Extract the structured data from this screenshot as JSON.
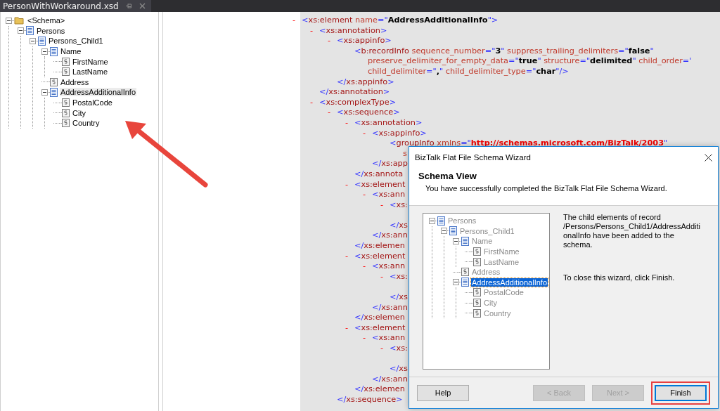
{
  "document_tab": {
    "title": "PersonWithWorkaround.xsd"
  },
  "schema_tree": [
    {
      "label": "<Schema>",
      "kind": "folder",
      "expanded": true,
      "selected": false,
      "children": [
        {
          "label": "Persons",
          "kind": "record",
          "expanded": true,
          "selected": false,
          "children": [
            {
              "label": "Persons_Child1",
              "kind": "record",
              "expanded": true,
              "selected": false,
              "children": [
                {
                  "label": "Name",
                  "kind": "record",
                  "expanded": true,
                  "selected": false,
                  "children": [
                    {
                      "label": "FirstName",
                      "kind": "field",
                      "selected": false
                    },
                    {
                      "label": "LastName",
                      "kind": "field",
                      "selected": false
                    }
                  ]
                },
                {
                  "label": "Address",
                  "kind": "field",
                  "selected": false
                },
                {
                  "label": "AddressAdditionalInfo",
                  "kind": "record",
                  "expanded": true,
                  "selected": true,
                  "children": [
                    {
                      "label": "PostalCode",
                      "kind": "field",
                      "selected": false
                    },
                    {
                      "label": "City",
                      "kind": "field",
                      "selected": false
                    },
                    {
                      "label": "Country",
                      "kind": "field",
                      "selected": false
                    }
                  ]
                }
              ]
            }
          ]
        }
      ]
    }
  ],
  "xml_view": [
    {
      "toggle": "-",
      "open": [
        {
          "kind": "punct",
          "text": "<"
        },
        {
          "kind": "tag",
          "text": "xs:element"
        },
        {
          "kind": "attr",
          "text": " name"
        },
        {
          "kind": "punct",
          "text": "=\""
        },
        {
          "kind": "value",
          "text": "AddressAdditionalInfo"
        },
        {
          "kind": "punct",
          "text": "\">"
        }
      ],
      "children": [
        {
          "toggle": "-",
          "open": [
            {
              "kind": "punct",
              "text": "<"
            },
            {
              "kind": "tag",
              "text": "xs:annotation"
            },
            {
              "kind": "punct",
              "text": ">"
            }
          ],
          "children": [
            {
              "toggle": "-",
              "open": [
                {
                  "kind": "punct",
                  "text": "<"
                },
                {
                  "kind": "tag",
                  "text": "xs:appinfo"
                },
                {
                  "kind": "punct",
                  "text": ">"
                }
              ],
              "children": [
                {
                  "open": [
                    {
                      "kind": "punct",
                      "text": "<"
                    },
                    {
                      "kind": "tag",
                      "text": "b:recordInfo"
                    },
                    {
                      "kind": "attr",
                      "text": " sequence_number"
                    },
                    {
                      "kind": "punct",
                      "text": "=\""
                    },
                    {
                      "kind": "value",
                      "text": "3"
                    },
                    {
                      "kind": "punct",
                      "text": "\""
                    },
                    {
                      "kind": "attr",
                      "text": " suppress_trailing_delimiters"
                    },
                    {
                      "kind": "punct",
                      "text": "=\""
                    },
                    {
                      "kind": "value",
                      "text": "false"
                    },
                    {
                      "kind": "punct",
                      "text": "\""
                    }
                  ],
                  "more": [
                    [
                      {
                        "kind": "attr",
                        "text": "preserve_delimiter_for_empty_data"
                      },
                      {
                        "kind": "punct",
                        "text": "=\""
                      },
                      {
                        "kind": "value",
                        "text": "true"
                      },
                      {
                        "kind": "punct",
                        "text": "\""
                      },
                      {
                        "kind": "attr",
                        "text": " structure"
                      },
                      {
                        "kind": "punct",
                        "text": "=\""
                      },
                      {
                        "kind": "value",
                        "text": "delimited"
                      },
                      {
                        "kind": "punct",
                        "text": "\""
                      },
                      {
                        "kind": "attr",
                        "text": " child_order"
                      },
                      {
                        "kind": "punct",
                        "text": "='"
                      }
                    ],
                    [
                      {
                        "kind": "attr",
                        "text": "child_delimiter"
                      },
                      {
                        "kind": "punct",
                        "text": "=\""
                      },
                      {
                        "kind": "value",
                        "text": ","
                      },
                      {
                        "kind": "punct",
                        "text": "\""
                      },
                      {
                        "kind": "attr",
                        "text": " child_delimiter_type"
                      },
                      {
                        "kind": "punct",
                        "text": "=\""
                      },
                      {
                        "kind": "value",
                        "text": "char"
                      },
                      {
                        "kind": "punct",
                        "text": "\"/>"
                      }
                    ]
                  ]
                }
              ],
              "close": [
                {
                  "kind": "punct",
                  "text": "</"
                },
                {
                  "kind": "tag",
                  "text": "xs:appinfo"
                },
                {
                  "kind": "punct",
                  "text": ">"
                }
              ]
            }
          ],
          "close": [
            {
              "kind": "punct",
              "text": "</"
            },
            {
              "kind": "tag",
              "text": "xs:annotation"
            },
            {
              "kind": "punct",
              "text": ">"
            }
          ]
        },
        {
          "toggle": "-",
          "open": [
            {
              "kind": "punct",
              "text": "<"
            },
            {
              "kind": "tag",
              "text": "xs:complexType"
            },
            {
              "kind": "punct",
              "text": ">"
            }
          ],
          "children": [
            {
              "toggle": "-",
              "open": [
                {
                  "kind": "punct",
                  "text": "<"
                },
                {
                  "kind": "tag",
                  "text": "xs:sequence"
                },
                {
                  "kind": "punct",
                  "text": ">"
                }
              ],
              "children": [
                {
                  "toggle": "-",
                  "open": [
                    {
                      "kind": "punct",
                      "text": "<"
                    },
                    {
                      "kind": "tag",
                      "text": "xs:annotation"
                    },
                    {
                      "kind": "punct",
                      "text": ">"
                    }
                  ],
                  "children": [
                    {
                      "toggle": "-",
                      "open": [
                        {
                          "kind": "punct",
                          "text": "<"
                        },
                        {
                          "kind": "tag",
                          "text": "xs:appinfo"
                        },
                        {
                          "kind": "punct",
                          "text": ">"
                        }
                      ],
                      "children": [
                        {
                          "open": [
                            {
                              "kind": "punct",
                              "text": "<"
                            },
                            {
                              "kind": "tag",
                              "text": "groupInfo"
                            },
                            {
                              "kind": "attr",
                              "text": " xmlns"
                            },
                            {
                              "kind": "punct",
                              "text": "=\""
                            },
                            {
                              "kind": "link",
                              "text": "http://schemas.microsoft.com/BizTalk/2003"
                            },
                            {
                              "kind": "punct",
                              "text": "\""
                            }
                          ],
                          "more": [
                            [
                              {
                                "kind": "attr",
                                "text": "s"
                              }
                            ]
                          ]
                        }
                      ],
                      "close": [
                        {
                          "kind": "punct",
                          "text": "</"
                        },
                        {
                          "kind": "tag",
                          "text": "xs:app"
                        }
                      ]
                    }
                  ],
                  "close": [
                    {
                      "kind": "punct",
                      "text": "</"
                    },
                    {
                      "kind": "tag",
                      "text": "xs:annota"
                    }
                  ]
                },
                {
                  "toggle": "-",
                  "open": [
                    {
                      "kind": "punct",
                      "text": "<"
                    },
                    {
                      "kind": "tag",
                      "text": "xs:element"
                    }
                  ],
                  "children": [
                    {
                      "toggle": "-",
                      "open": [
                        {
                          "kind": "punct",
                          "text": "<"
                        },
                        {
                          "kind": "tag",
                          "text": "xs:ann"
                        }
                      ],
                      "children": [
                        {
                          "toggle": "-",
                          "open": [
                            {
                              "kind": "punct",
                              "text": "<"
                            },
                            {
                              "kind": "tag",
                              "text": "xs:"
                            }
                          ],
                          "close": [
                            {
                              "kind": "punct",
                              "text": "</"
                            },
                            {
                              "kind": "tag",
                              "text": "xs"
                            }
                          ]
                        }
                      ],
                      "close": [
                        {
                          "kind": "punct",
                          "text": "</"
                        },
                        {
                          "kind": "tag",
                          "text": "xs:ann"
                        }
                      ]
                    }
                  ],
                  "close": [
                    {
                      "kind": "punct",
                      "text": "</"
                    },
                    {
                      "kind": "tag",
                      "text": "xs:elemen"
                    }
                  ]
                },
                {
                  "toggle": "-",
                  "open": [
                    {
                      "kind": "punct",
                      "text": "<"
                    },
                    {
                      "kind": "tag",
                      "text": "xs:element"
                    }
                  ],
                  "children": [
                    {
                      "toggle": "-",
                      "open": [
                        {
                          "kind": "punct",
                          "text": "<"
                        },
                        {
                          "kind": "tag",
                          "text": "xs:ann"
                        }
                      ],
                      "children": [
                        {
                          "toggle": "-",
                          "open": [
                            {
                              "kind": "punct",
                              "text": "<"
                            },
                            {
                              "kind": "tag",
                              "text": "xs:"
                            }
                          ],
                          "close": [
                            {
                              "kind": "punct",
                              "text": "</"
                            },
                            {
                              "kind": "tag",
                              "text": "xs"
                            }
                          ]
                        }
                      ],
                      "close": [
                        {
                          "kind": "punct",
                          "text": "</"
                        },
                        {
                          "kind": "tag",
                          "text": "xs:ann"
                        }
                      ]
                    }
                  ],
                  "close": [
                    {
                      "kind": "punct",
                      "text": "</"
                    },
                    {
                      "kind": "tag",
                      "text": "xs:elemen"
                    }
                  ]
                },
                {
                  "toggle": "-",
                  "open": [
                    {
                      "kind": "punct",
                      "text": "<"
                    },
                    {
                      "kind": "tag",
                      "text": "xs:element"
                    }
                  ],
                  "children": [
                    {
                      "toggle": "-",
                      "open": [
                        {
                          "kind": "punct",
                          "text": "<"
                        },
                        {
                          "kind": "tag",
                          "text": "xs:ann"
                        }
                      ],
                      "children": [
                        {
                          "toggle": "-",
                          "open": [
                            {
                              "kind": "punct",
                              "text": "<"
                            },
                            {
                              "kind": "tag",
                              "text": "xs:"
                            }
                          ],
                          "close": [
                            {
                              "kind": "punct",
                              "text": "</"
                            },
                            {
                              "kind": "tag",
                              "text": "xs"
                            }
                          ]
                        }
                      ],
                      "close": [
                        {
                          "kind": "punct",
                          "text": "</"
                        },
                        {
                          "kind": "tag",
                          "text": "xs:ann"
                        }
                      ]
                    }
                  ],
                  "close": [
                    {
                      "kind": "punct",
                      "text": "</"
                    },
                    {
                      "kind": "tag",
                      "text": "xs:elemen"
                    }
                  ]
                }
              ],
              "close": [
                {
                  "kind": "punct",
                  "text": "</"
                },
                {
                  "kind": "tag",
                  "text": "xs:sequence"
                },
                {
                  "kind": "punct",
                  "text": ">"
                }
              ]
            }
          ]
        }
      ]
    }
  ],
  "wizard": {
    "title": "BizTalk Flat File Schema Wizard",
    "heading": "Schema View",
    "subtitle": "You have successfully completed the BizTalk Flat File Schema Wizard.",
    "tree": {
      "disabled": true,
      "items": [
        {
          "label": "Persons",
          "kind": "record",
          "expanded": true,
          "selected": false,
          "children": [
            {
              "label": "Persons_Child1",
              "kind": "record",
              "expanded": true,
              "selected": false,
              "children": [
                {
                  "label": "Name",
                  "kind": "record",
                  "expanded": true,
                  "selected": false,
                  "children": [
                    {
                      "label": "FirstName",
                      "kind": "field",
                      "selected": false
                    },
                    {
                      "label": "LastName",
                      "kind": "field",
                      "selected": false
                    }
                  ]
                },
                {
                  "label": "Address",
                  "kind": "field",
                  "selected": false
                },
                {
                  "label": "AddressAdditionalInfo",
                  "kind": "record",
                  "expanded": true,
                  "selected": true,
                  "children": [
                    {
                      "label": "PostalCode",
                      "kind": "field",
                      "selected": false
                    },
                    {
                      "label": "City",
                      "kind": "field",
                      "selected": false
                    },
                    {
                      "label": "Country",
                      "kind": "field",
                      "selected": false
                    }
                  ]
                }
              ]
            }
          ]
        }
      ]
    },
    "messages": [
      "The child elements of record /Persons/Persons_Child1/AddressAdditionalInfo have been added to the schema.",
      "To close this wizard, click Finish."
    ],
    "buttons": [
      {
        "label": "Help",
        "disabled": false,
        "default": false,
        "highlighted": false
      },
      {
        "label": "< Back",
        "disabled": true,
        "default": false,
        "highlighted": false
      },
      {
        "label": "Next >",
        "disabled": true,
        "default": false,
        "highlighted": false
      },
      {
        "label": "Finish",
        "disabled": false,
        "default": true,
        "highlighted": true
      }
    ]
  }
}
